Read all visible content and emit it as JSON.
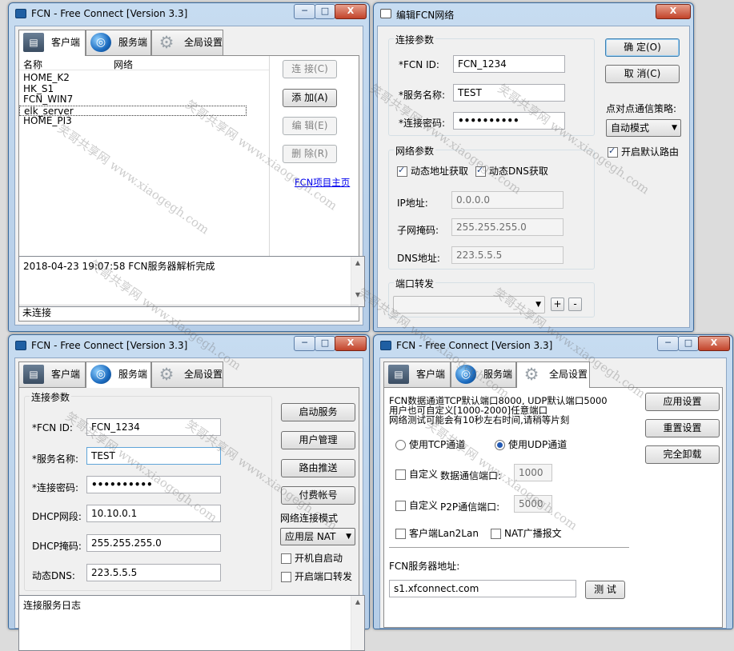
{
  "win1": {
    "title": "FCN - Free Connect [Version 3.3]",
    "tabs": [
      "客户端",
      "服务端",
      "全局设置"
    ],
    "list_header": {
      "name": "名称",
      "network": "网络"
    },
    "clients": [
      "HOME_K2",
      "HK_S1",
      "FCN_WIN7",
      "elk_server",
      "HOME_PI3"
    ],
    "buttons": {
      "connect": "连 接(C)",
      "add": "添 加(A)",
      "edit": "编 辑(E)",
      "delete": "删 除(R)"
    },
    "homepage_link": "FCN项目主页",
    "log": "2018-04-23 19:07:58 FCN服务器解析完成",
    "status": "未连接"
  },
  "win2": {
    "title": "编辑FCN网络",
    "group_conn": "连接参数",
    "fcn_id_label": "*FCN ID:",
    "fcn_id": "FCN_1234",
    "svc_name_label": "*服务名称:",
    "svc_name": "TEST",
    "pwd_label": "*连接密码:",
    "pwd": "••••••••••",
    "group_net": "网络参数",
    "dyn_addr": "动态地址获取",
    "dyn_dns": "动态DNS获取",
    "ip_label": "IP地址:",
    "ip": "0.0.0.0",
    "mask_label": "子网掩码:",
    "mask": "255.255.255.0",
    "dns_label": "DNS地址:",
    "dns": "223.5.5.5",
    "group_port": "端口转发",
    "ok": "确 定(O)",
    "cancel": "取 消(C)",
    "p2p_label": "点对点通信策略:",
    "p2p_mode": "自动模式",
    "default_route": "开启默认路由"
  },
  "win3": {
    "title": "FCN - Free Connect [Version 3.3]",
    "tabs": [
      "客户端",
      "服务端",
      "全局设置"
    ],
    "group_conn": "连接参数",
    "fcn_id_label": "*FCN ID:",
    "fcn_id": "FCN_1234",
    "svc_name_label": "*服务名称:",
    "svc_name": "TEST",
    "pwd_label": "*连接密码:",
    "pwd": "••••••••••",
    "dhcp_seg_label": "DHCP网段:",
    "dhcp_seg": "10.10.0.1",
    "dhcp_mask_label": "DHCP掩码:",
    "dhcp_mask": "255.255.255.0",
    "dyn_dns_label": "动态DNS:",
    "dyn_dns": "223.5.5.5",
    "buttons": {
      "start": "启动服务",
      "users": "用户管理",
      "routes": "路由推送",
      "pay": "付费帐号"
    },
    "conn_mode_label": "网络连接模式",
    "conn_mode": "应用层 NAT",
    "autostart": "开机自启动",
    "port_fwd": "开启端口转发",
    "log": "连接服务日志"
  },
  "win4": {
    "title": "FCN - Free Connect [Version 3.3]",
    "tabs": [
      "客户端",
      "服务端",
      "全局设置"
    ],
    "info": [
      "FCN数据通道TCP默认端口8000, UDP默认端口5000",
      "用户也可自定义[1000-2000]任意端口",
      "网络测试可能会有10秒左右时间,请稍等片刻"
    ],
    "use_tcp": "使用TCP通道",
    "use_udp": "使用UDP通道",
    "custom": "自定义",
    "data_port_label": "数据通信端口:",
    "data_port": "1000",
    "p2p_port_label": "P2P通信端口:",
    "p2p_port": "5000",
    "lan2lan": "客户端Lan2Lan",
    "nat_bcast": "NAT广播报文",
    "server_addr_label": "FCN服务器地址:",
    "server_addr": "s1.xfconnect.com",
    "test": "测 试",
    "buttons": {
      "apply": "应用设置",
      "reset": "重置设置",
      "uninstall": "完全卸载"
    }
  },
  "watermark": "笑哥共享网 www.xiaogegh.com",
  "win_buttons": {
    "min": "─",
    "max": "□",
    "close": "X"
  }
}
